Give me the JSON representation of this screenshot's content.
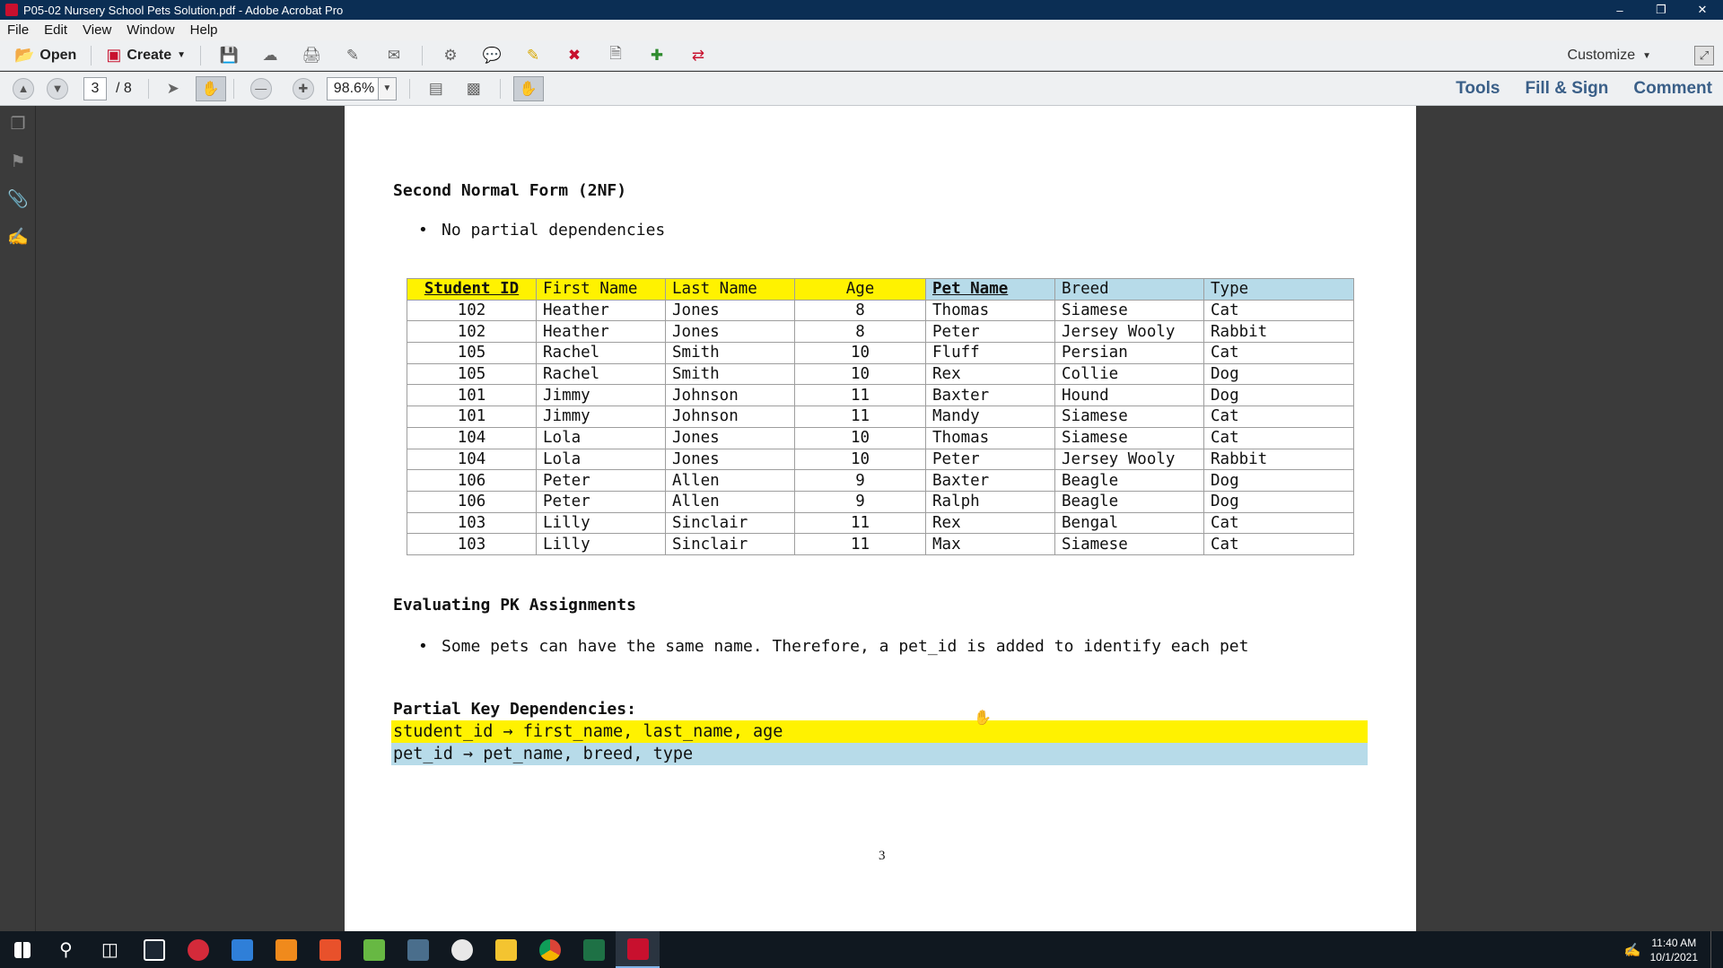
{
  "window": {
    "title": "P05-02 Nursery School Pets Solution.pdf - Adobe Acrobat Pro"
  },
  "menu": [
    "File",
    "Edit",
    "View",
    "Window",
    "Help"
  ],
  "toolbar": {
    "open_label": "Open",
    "create_label": "Create",
    "customize_label": "Customize"
  },
  "nav": {
    "current_page": "3",
    "total_pages": "/ 8",
    "zoom": "98.6%"
  },
  "right_links": [
    "Tools",
    "Fill & Sign",
    "Comment"
  ],
  "document": {
    "heading_2nf": "Second Normal Form (2NF)",
    "bullet_2nf": "No partial dependencies",
    "table": {
      "headers": [
        "Student ID",
        "First Name",
        "Last Name",
        "Age",
        "Pet Name",
        "Breed",
        "Type"
      ],
      "rows": [
        [
          "102",
          "Heather",
          "Jones",
          "8",
          "Thomas",
          "Siamese",
          "Cat"
        ],
        [
          "102",
          "Heather",
          "Jones",
          "8",
          "Peter",
          "Jersey Wooly",
          "Rabbit"
        ],
        [
          "105",
          "Rachel",
          "Smith",
          "10",
          "Fluff",
          "Persian",
          "Cat"
        ],
        [
          "105",
          "Rachel",
          "Smith",
          "10",
          "Rex",
          "Collie",
          "Dog"
        ],
        [
          "101",
          "Jimmy",
          "Johnson",
          "11",
          "Baxter",
          "Hound",
          "Dog"
        ],
        [
          "101",
          "Jimmy",
          "Johnson",
          "11",
          "Mandy",
          "Siamese",
          "Cat"
        ],
        [
          "104",
          "Lola",
          "Jones",
          "10",
          "Thomas",
          "Siamese",
          "Cat"
        ],
        [
          "104",
          "Lola",
          "Jones",
          "10",
          "Peter",
          "Jersey Wooly",
          "Rabbit"
        ],
        [
          "106",
          "Peter",
          "Allen",
          "9",
          "Baxter",
          "Beagle",
          "Dog"
        ],
        [
          "106",
          "Peter",
          "Allen",
          "9",
          "Ralph",
          "Beagle",
          "Dog"
        ],
        [
          "103",
          "Lilly",
          "Sinclair",
          "11",
          "Rex",
          "Bengal",
          "Cat"
        ],
        [
          "103",
          "Lilly",
          "Sinclair",
          "11",
          "Max",
          "Siamese",
          "Cat"
        ]
      ]
    },
    "heading_pk": "Evaluating PK Assignments",
    "bullet_pk": "Some pets can have the same name. Therefore, a pet_id is added to identify each pet",
    "heading_partial": "Partial Key Dependencies:",
    "dep1": "student_id → first_name, last_name, age",
    "dep2": "pet_id → pet_name, breed, type",
    "page_number": "3"
  },
  "colors": {
    "highlight_yellow": "#fff200",
    "highlight_blue": "#b7dbe9",
    "title_bar": "#0b2e54"
  },
  "taskbar": {
    "time": "11:40 AM",
    "date": "10/1/2021"
  }
}
